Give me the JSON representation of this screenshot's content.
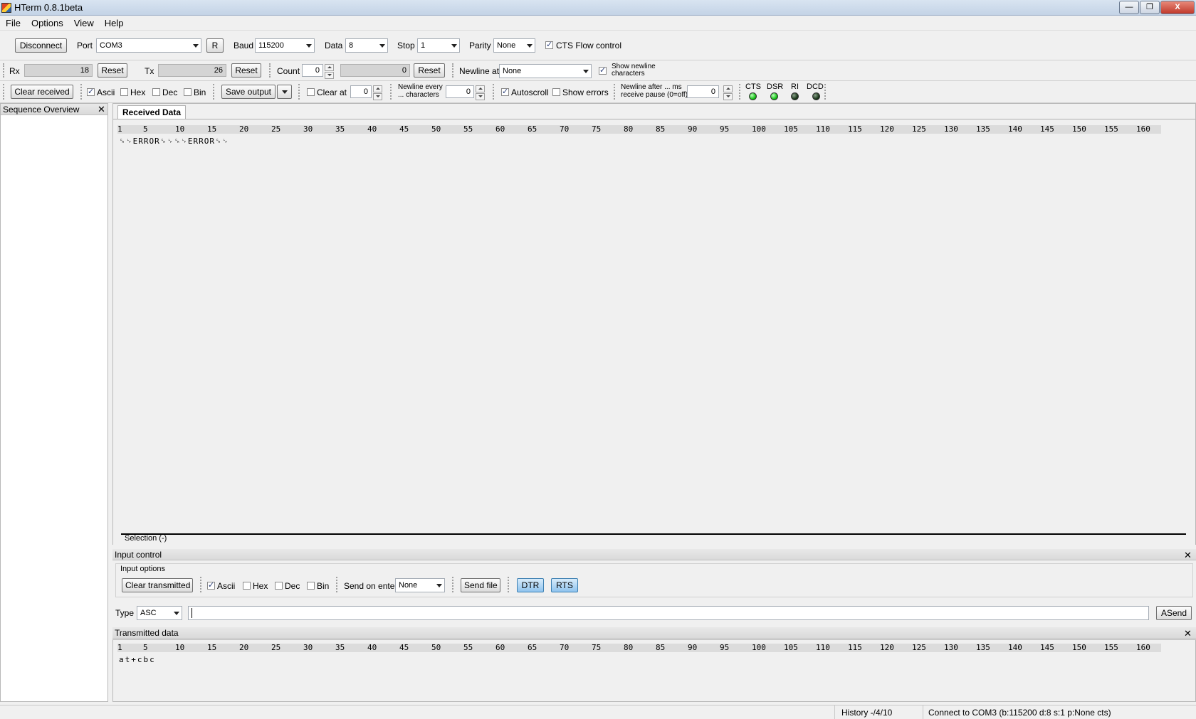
{
  "window": {
    "title": "HTerm 0.8.1beta",
    "minimize_glyph": "—",
    "maximize_glyph": "❐",
    "close_glyph": "X"
  },
  "menu": [
    "File",
    "Options",
    "View",
    "Help"
  ],
  "connection": {
    "disconnect_label": "Disconnect",
    "port_label": "Port",
    "port_value": "COM3",
    "rescan_label": "R",
    "baud_label": "Baud",
    "baud_value": "115200",
    "data_label": "Data",
    "data_value": "8",
    "stop_label": "Stop",
    "stop_value": "1",
    "parity_label": "Parity",
    "parity_value": "None",
    "cts_label": "CTS Flow control",
    "cts_checked": true
  },
  "counters": {
    "rx_label": "Rx",
    "rx_value": "18",
    "rx_reset": "Reset",
    "tx_label": "Tx",
    "tx_value": "26",
    "tx_reset": "Reset",
    "count_label": "Count",
    "count_value": "0",
    "count_total": "0",
    "count_reset": "Reset",
    "newline_at_label": "Newline at",
    "newline_at_value": "None",
    "show_newline_line1": "Show newline",
    "show_newline_line2": "characters",
    "show_newline_checked": true
  },
  "display": {
    "clear_received": "Clear received",
    "ascii": "Ascii",
    "hex": "Hex",
    "dec": "Dec",
    "bin": "Bin",
    "save_output": "Save output",
    "clear_at_label": "Clear at",
    "clear_at_value": "0",
    "newline_every_line1": "Newline every",
    "newline_every_line2": "... characters",
    "newline_every_value": "0",
    "autoscroll": "Autoscroll",
    "show_errors": "Show errors",
    "newline_after_line1": "Newline after ... ms",
    "newline_after_line2": "receive pause (0=off)",
    "newline_after_value": "0",
    "led_labels": [
      "CTS",
      "DSR",
      "RI",
      "DCD"
    ],
    "led_colors": [
      "#19c419",
      "#19c419",
      "#1d3a1d",
      "#1d3a1d"
    ]
  },
  "sequence_overview": {
    "title": "Sequence Overview",
    "close_glyph": "✕"
  },
  "received": {
    "tab_label": "Received Data",
    "ruler": [
      "1",
      "5",
      "10",
      "15",
      "20",
      "25",
      "30",
      "35",
      "40",
      "45",
      "50",
      "55",
      "60",
      "65",
      "70",
      "75",
      "80",
      "85",
      "90",
      "95",
      "100",
      "105",
      "110",
      "115",
      "120",
      "125",
      "130",
      "135",
      "140",
      "145",
      "150",
      "155",
      "160"
    ],
    "text": "␍␊ERROR␍␊␍␊ERROR␍␊",
    "selection": "Selection (-)"
  },
  "input_control": {
    "title": "Input control",
    "close_glyph": "✕",
    "options_label": "Input options",
    "clear_transmitted": "Clear transmitted",
    "ascii": "Ascii",
    "hex": "Hex",
    "dec": "Dec",
    "bin": "Bin",
    "send_on_enter_label": "Send on enter",
    "send_on_enter_value": "None",
    "send_file": "Send file",
    "dtr": "DTR",
    "rts": "RTS",
    "type_label": "Type",
    "type_value": "ASC",
    "input_value": "",
    "asend": "ASend"
  },
  "transmitted": {
    "title": "Transmitted data",
    "close_glyph": "✕",
    "ruler": [
      "1",
      "5",
      "10",
      "15",
      "20",
      "25",
      "30",
      "35",
      "40",
      "45",
      "50",
      "55",
      "60",
      "65",
      "70",
      "75",
      "80",
      "85",
      "90",
      "95",
      "100",
      "105",
      "110",
      "115",
      "120",
      "125",
      "130",
      "135",
      "140",
      "145",
      "150",
      "155",
      "160"
    ],
    "text": "at+cbc"
  },
  "status": {
    "history": "History -/4/10",
    "connection": "Connect to COM3 (b:115200 d:8 s:1 p:None cts)"
  }
}
